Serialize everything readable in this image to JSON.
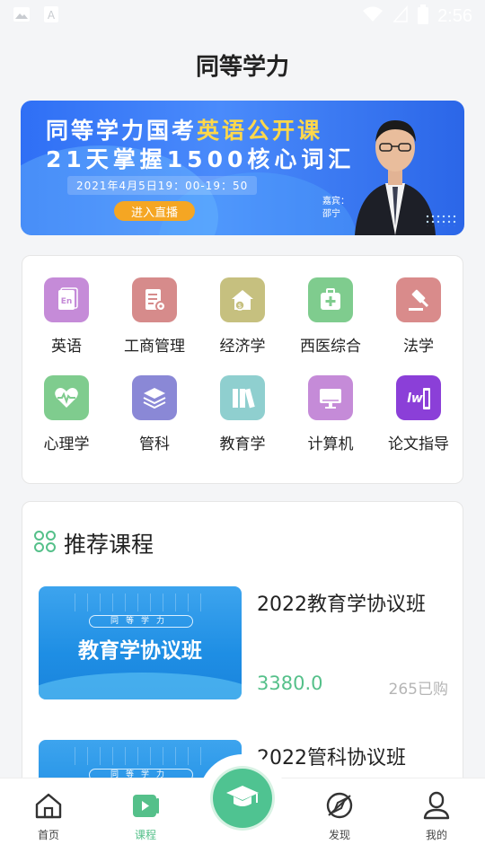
{
  "status_bar": {
    "time": "2:56"
  },
  "header": {
    "title": "同等学力"
  },
  "banner": {
    "line1_a": "同等学力国考",
    "line1_b": "英语公开课",
    "line2": "21天掌握1500核心词汇",
    "date": "2021年4月5日19：00-19：50",
    "cta": "进入直播",
    "guest_label": "嘉宾：",
    "guest_name": "邵宁"
  },
  "categories": [
    {
      "label": "英语",
      "icon": "english-book-icon",
      "color": "#c58bd8"
    },
    {
      "label": "工商管理",
      "icon": "document-gear-icon",
      "color": "#d68b8b"
    },
    {
      "label": "经济学",
      "icon": "house-coin-icon",
      "color": "#c6c07f"
    },
    {
      "label": "西医综合",
      "icon": "medical-kit-icon",
      "color": "#7fcc8e"
    },
    {
      "label": "法学",
      "icon": "gavel-icon",
      "color": "#d98b8b"
    },
    {
      "label": "心理学",
      "icon": "heart-pulse-icon",
      "color": "#7fcc8e"
    },
    {
      "label": "管科",
      "icon": "layers-icon",
      "color": "#8a88d6"
    },
    {
      "label": "教育学",
      "icon": "books-icon",
      "color": "#8fcfcf"
    },
    {
      "label": "计算机",
      "icon": "monitor-icon",
      "color": "#c58bd8"
    },
    {
      "label": "论文指导",
      "icon": "word-doc-icon",
      "color": "#8b3fd8"
    }
  ],
  "recommend": {
    "title": "推荐课程",
    "courses": [
      {
        "thumb_tag": "同等学力",
        "thumb_title": "教育学协议班",
        "name": "2022教育学协议班",
        "price": "3380.0",
        "sold": "265已购"
      },
      {
        "thumb_tag": "同等学力",
        "thumb_title": "",
        "name": "2022管科协议班",
        "price": "",
        "sold": ""
      }
    ]
  },
  "bottom_nav": {
    "home": "首页",
    "courses": "课程",
    "discover": "发现",
    "mine": "我的"
  },
  "colors": {
    "accent": "#55c08a",
    "banner_blue": "#2f6ff5",
    "cta_orange": "#f5a623"
  }
}
